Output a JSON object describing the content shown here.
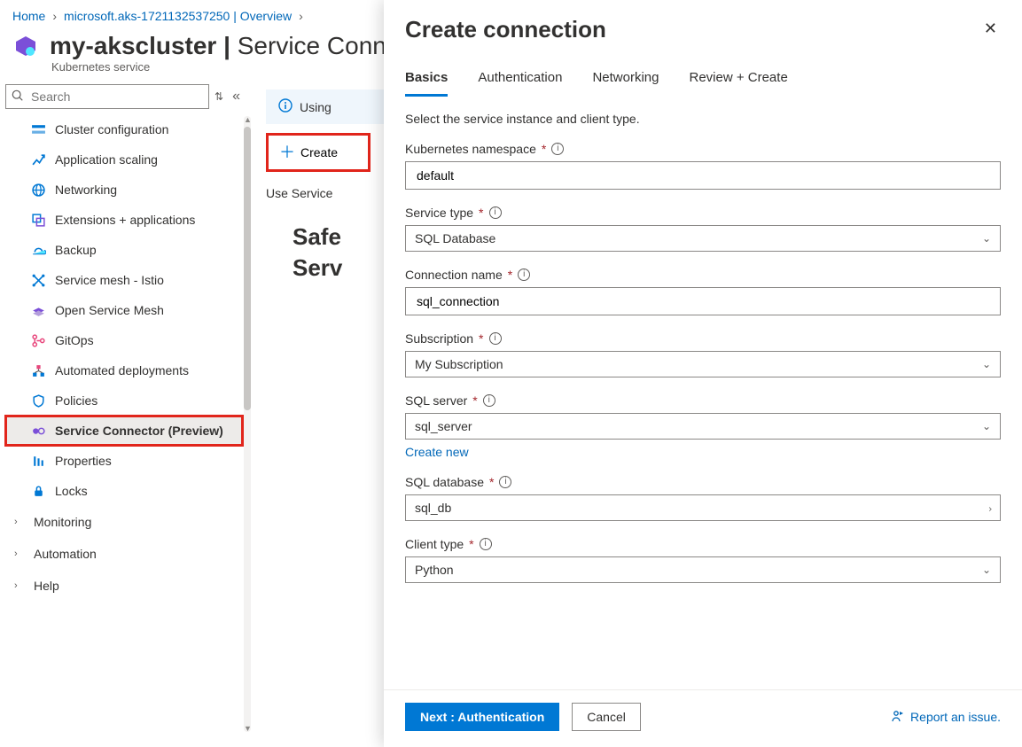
{
  "breadcrumb": {
    "home": "Home",
    "resource": "microsoft.aks-1721132537250 | Overview"
  },
  "page": {
    "title": "my-akscluster",
    "title_sep": " | ",
    "title_section": "Service Connector",
    "subtitle": "Kubernetes service"
  },
  "search": {
    "placeholder": "Search"
  },
  "sidebar": {
    "items": [
      {
        "label": "Cluster configuration",
        "icon": "cluster-config-icon"
      },
      {
        "label": "Application scaling",
        "icon": "app-scaling-icon"
      },
      {
        "label": "Networking",
        "icon": "networking-icon"
      },
      {
        "label": "Extensions + applications",
        "icon": "extensions-icon"
      },
      {
        "label": "Backup",
        "icon": "backup-icon"
      },
      {
        "label": "Service mesh - Istio",
        "icon": "istio-icon"
      },
      {
        "label": "Open Service Mesh",
        "icon": "osm-icon"
      },
      {
        "label": "GitOps",
        "icon": "gitops-icon"
      },
      {
        "label": "Automated deployments",
        "icon": "auto-deploy-icon"
      },
      {
        "label": "Policies",
        "icon": "policies-icon"
      },
      {
        "label": "Service Connector (Preview)",
        "icon": "service-connector-icon",
        "selected": true
      },
      {
        "label": "Properties",
        "icon": "properties-icon"
      },
      {
        "label": "Locks",
        "icon": "locks-icon"
      }
    ],
    "sections": [
      {
        "label": "Monitoring"
      },
      {
        "label": "Automation"
      },
      {
        "label": "Help"
      }
    ]
  },
  "content": {
    "infobar_prefix": "Using",
    "create_label": "Create",
    "desc_prefix": "Use Service",
    "intro_heading_line1": "Safe",
    "intro_heading_line2": "Serv"
  },
  "blade": {
    "title": "Create connection",
    "tabs": {
      "basics": "Basics",
      "auth": "Authentication",
      "networking": "Networking",
      "review": "Review + Create"
    },
    "hint": "Select the service instance and client type.",
    "fields": {
      "namespace": {
        "label": "Kubernetes namespace",
        "value": "default"
      },
      "service_type": {
        "label": "Service type",
        "value": "SQL Database"
      },
      "conn_name": {
        "label": "Connection name",
        "value": "sql_connection"
      },
      "subscription": {
        "label": "Subscription",
        "value": "My Subscription"
      },
      "sql_server": {
        "label": "SQL server",
        "value": "sql_server",
        "create_new": "Create new"
      },
      "sql_db": {
        "label": "SQL database",
        "value": "sql_db"
      },
      "client_type": {
        "label": "Client type",
        "value": "Python"
      }
    },
    "footer": {
      "next": "Next : Authentication",
      "cancel": "Cancel",
      "report": "Report an issue."
    }
  }
}
